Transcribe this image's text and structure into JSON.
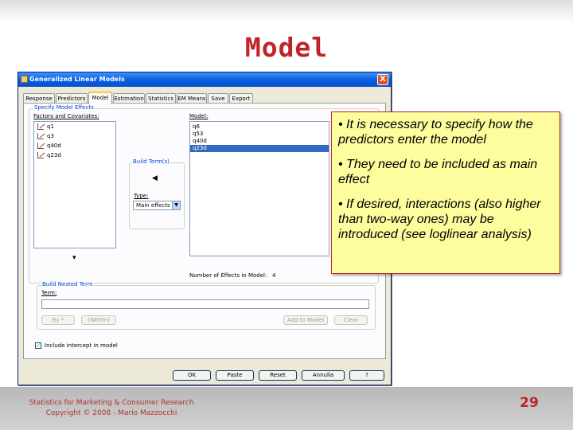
{
  "slide": {
    "title": "Model",
    "footer_line1": "Statistics for Marketing & Consumer Research",
    "footer_line2": "Copyright © 2008 - Mario Mazzocchi",
    "page_number": "29",
    "accent_color": "#c0242a"
  },
  "dialog": {
    "title": "Generalized Linear Models",
    "close_label": "X",
    "tabs": [
      {
        "label": "Response"
      },
      {
        "label": "Predictors"
      },
      {
        "label": "Model",
        "active": true
      },
      {
        "label": "Estimation"
      },
      {
        "label": "Statistics"
      },
      {
        "label": "EM Means"
      },
      {
        "label": "Save"
      },
      {
        "label": "Export"
      }
    ],
    "specify_group_label": "Specify Model Effects",
    "factors_label": "Factors and Covariates:",
    "factors": [
      "q1",
      "q3",
      "q40d",
      "q23d"
    ],
    "model_label": "Model:",
    "model_items": [
      "q6",
      "q53",
      "q40d",
      "q23d"
    ],
    "model_selected_index": 3,
    "build_terms_label": "Build Term(s)",
    "type_label": "Type:",
    "type_value": "Main effects",
    "effects_count_label": "Number of Effects in Model:",
    "effects_count": "4",
    "nested_group_label": "Build Nested Term",
    "term_label": "Term:",
    "by_button": "By *",
    "within_button": "(Within)",
    "add_to_model_button": "Add to Model",
    "clear_button": "Clear",
    "intercept_label": "Include intercept in model",
    "intercept_checked": true,
    "ok_button": "OK",
    "paste_button": "Paste",
    "reset_button": "Reset",
    "cancel_button": "Annulla",
    "help_button": "?"
  },
  "callout": {
    "bullets": [
      "• It is necessary to specify how the predictors enter the model",
      "• They need to be included as main effect",
      "• If desired, interactions (also higher than two-way ones) may be introduced (see loglinear analysis)"
    ]
  }
}
